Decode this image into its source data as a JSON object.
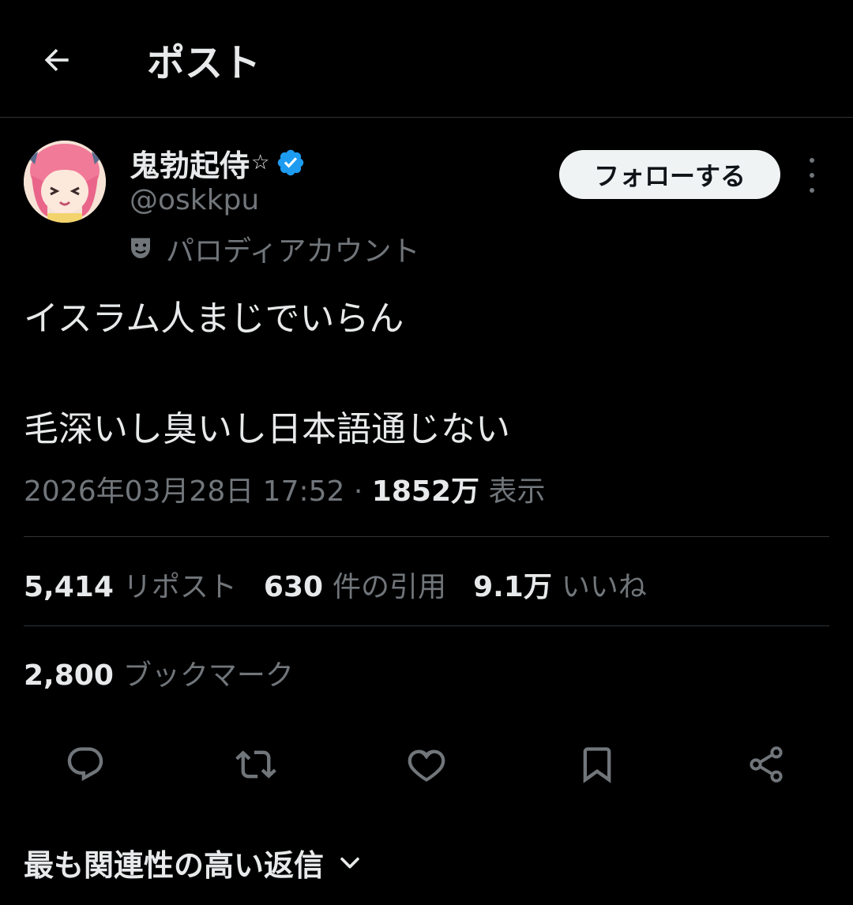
{
  "header": {
    "back_icon": "arrow-left-icon",
    "title": "ポスト"
  },
  "author": {
    "display_name": "鬼勃起侍",
    "name_badge": "☆",
    "verified": true,
    "verified_color": "#1d9bf0",
    "handle": "@oskkpu",
    "parody_label": "パロディアカウント",
    "parody_icon": "theater-mask-icon",
    "follow_label": "フォローする",
    "more_icon": "more-vertical-icon"
  },
  "post": {
    "line1": "イスラム人まじでいらん",
    "line2": "毛深いし臭いし日本語通じない",
    "timestamp": "2026年03月28日 17:52",
    "separator": "·",
    "views_count": "1852万",
    "views_label": "表示"
  },
  "stats": {
    "reposts_count": "5,414",
    "reposts_label": "リポスト",
    "quotes_count": "630",
    "quotes_label": "件の引用",
    "likes_count": "9.1万",
    "likes_label": "いいね",
    "bookmarks_count": "2,800",
    "bookmarks_label": "ブックマーク"
  },
  "actions": [
    "reply-icon",
    "repost-icon",
    "like-icon",
    "bookmark-icon",
    "share-icon"
  ],
  "replies_sort": {
    "label": "最も関連性の高い返信",
    "icon": "chevron-down-icon"
  },
  "colors": {
    "background": "#000000",
    "text": "#e7e9ea",
    "muted": "#71767b",
    "divider": "#2f3336",
    "accent": "#1d9bf0"
  }
}
